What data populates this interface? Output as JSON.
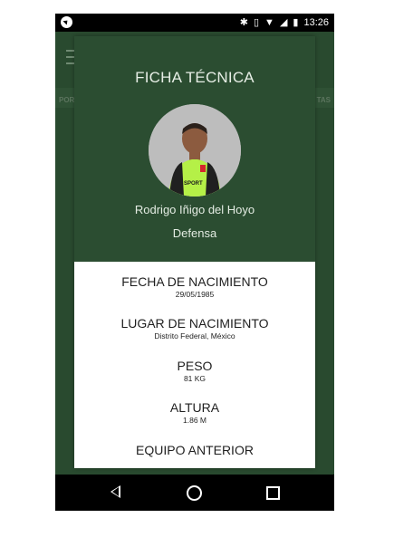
{
  "status_bar": {
    "time": "13:26",
    "left_icon": "navigation-icon",
    "right_icons": [
      "bluetooth-icon",
      "vibrate-icon",
      "wifi-icon",
      "cellular-signal-icon",
      "battery-icon"
    ]
  },
  "background_app": {
    "tab_left": "POR",
    "tab_right": "TAS"
  },
  "modal": {
    "title": "FICHA TÉCNICA",
    "player_name": "Rodrigo Iñigo del Hoyo",
    "position": "Defensa",
    "details": [
      {
        "label": "FECHA DE NACIMIENTO",
        "value": "29/05/1985"
      },
      {
        "label": "LUGAR DE NACIMIENTO",
        "value": "Distrito Federal, México"
      },
      {
        "label": "PESO",
        "value": "81 KG"
      },
      {
        "label": "ALTURA",
        "value": "1.86 M"
      },
      {
        "label": "EQUIPO ANTERIOR",
        "value": ""
      }
    ]
  },
  "colors": {
    "green": "#294a2f",
    "modal_green": "#2b4d31",
    "white": "#ffffff",
    "jersey": "#b5f047"
  }
}
